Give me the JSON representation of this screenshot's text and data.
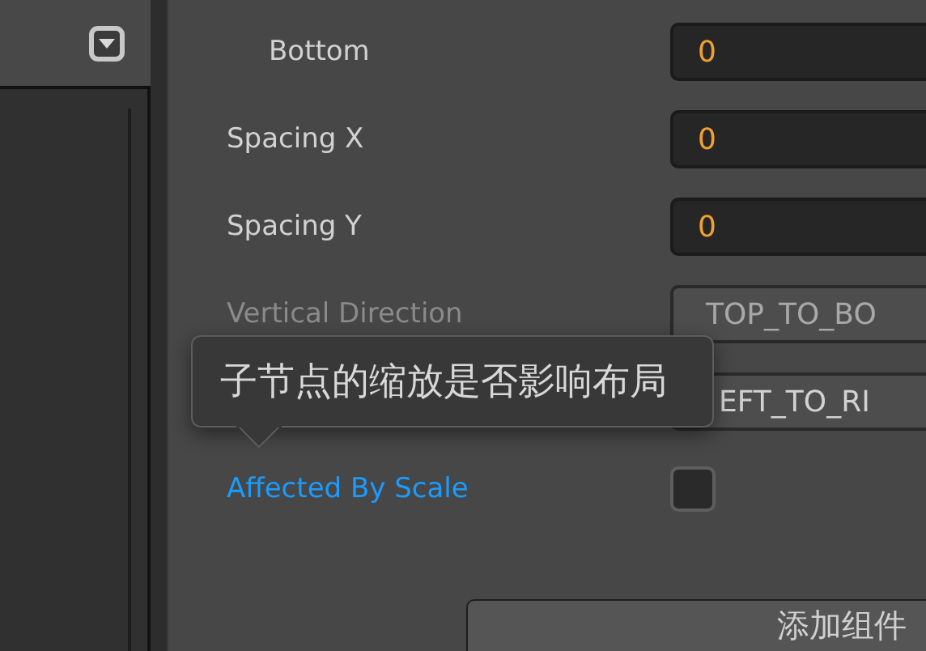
{
  "properties": [
    {
      "kind": "number",
      "label": "Bottom",
      "indented": true,
      "value": "0",
      "disabled": false
    },
    {
      "kind": "number",
      "label": "Spacing X",
      "indented": false,
      "value": "0",
      "disabled": false
    },
    {
      "kind": "number",
      "label": "Spacing Y",
      "indented": false,
      "value": "0",
      "disabled": false
    },
    {
      "kind": "enum",
      "label": "Vertical Direction",
      "indented": false,
      "value": "TOP_TO_BO",
      "disabled": true
    },
    {
      "kind": "enum",
      "value": "EFT_TO_RI",
      "disabled": false
    },
    {
      "kind": "checkbox",
      "label": "Affected By Scale",
      "indented": false,
      "checked": false,
      "disabled": false,
      "highlighted": true
    }
  ],
  "tooltip": "子节点的缩放是否影响布局",
  "add_component_button": "添加组件"
}
